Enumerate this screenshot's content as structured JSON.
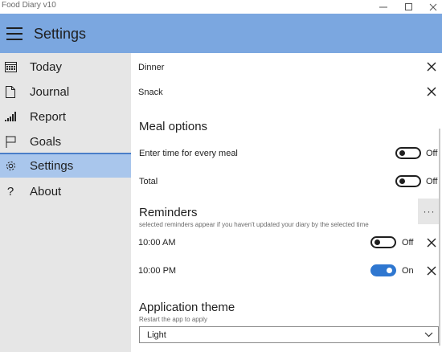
{
  "window": {
    "title": "Food Diary v10",
    "minimize_icon": "minimize-icon",
    "maximize_icon": "maximize-icon",
    "close_icon": "close-icon"
  },
  "appbar": {
    "menu_icon": "hamburger-menu-icon",
    "title": "Settings",
    "color": "#7ba7e0"
  },
  "sidebar": {
    "items": [
      {
        "label": "Today",
        "icon": "calendar-icon",
        "active": false
      },
      {
        "label": "Journal",
        "icon": "document-icon",
        "active": false
      },
      {
        "label": "Report",
        "icon": "bar-chart-icon",
        "active": false
      },
      {
        "label": "Goals",
        "icon": "flag-icon",
        "active": false
      },
      {
        "label": "Settings",
        "icon": "gear-icon",
        "active": true
      },
      {
        "label": "About",
        "icon": "question-icon",
        "active": false
      }
    ],
    "active_color": "#a9c6ec"
  },
  "meals": [
    {
      "label": "Dinner"
    },
    {
      "label": "Snack"
    }
  ],
  "meal_options": {
    "title": "Meal options",
    "options": [
      {
        "label": "Enter time for every meal",
        "state": "Off"
      },
      {
        "label": "Total",
        "state": "Off"
      }
    ]
  },
  "reminders": {
    "title": "Reminders",
    "hint": "selected reminders appear if you haven't updated your diary by the selected time",
    "more_label": "···",
    "items": [
      {
        "time": "10:00 AM",
        "state": "Off"
      },
      {
        "time": "10:00 PM",
        "state": "On"
      }
    ]
  },
  "theme": {
    "title": "Application theme",
    "hint": "Restart the app to apply",
    "selected": "Light"
  },
  "colors": {
    "toggle_on": "#2f77d0"
  }
}
